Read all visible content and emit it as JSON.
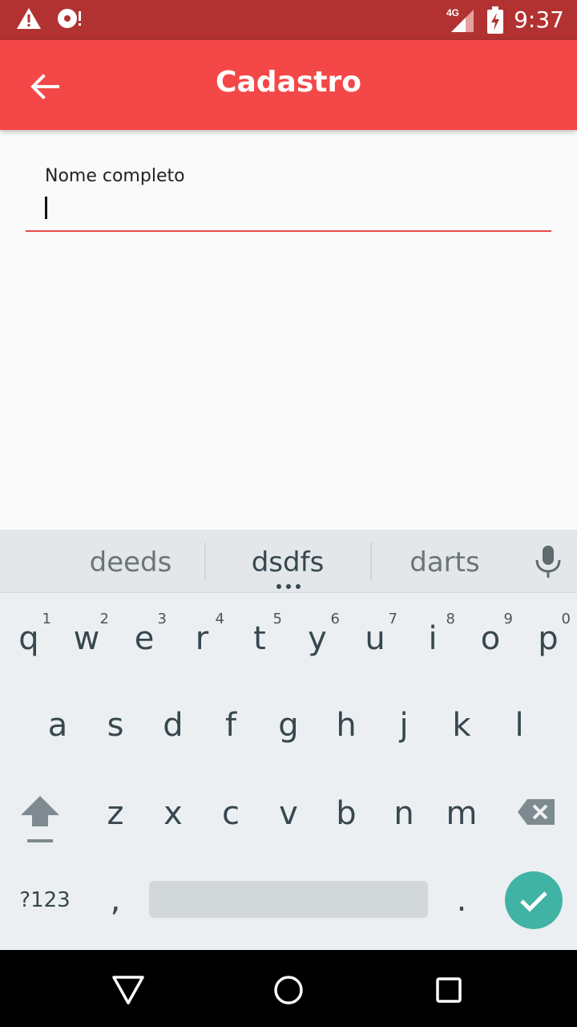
{
  "status_bar": {
    "time": "9:37",
    "network": "4G",
    "icons": [
      "warning-icon",
      "disc-icon",
      "signal-icon",
      "battery-charging-icon"
    ]
  },
  "app_bar": {
    "title": "Cadastro",
    "back_icon": "arrow-back-icon"
  },
  "form": {
    "name_label": "Nome completo",
    "name_value": ""
  },
  "keyboard": {
    "suggestions": [
      "deeds",
      "dsdfs",
      "darts"
    ],
    "row1": [
      {
        "key": "q",
        "hint": "1"
      },
      {
        "key": "w",
        "hint": "2"
      },
      {
        "key": "e",
        "hint": "3"
      },
      {
        "key": "r",
        "hint": "4"
      },
      {
        "key": "t",
        "hint": "5"
      },
      {
        "key": "y",
        "hint": "6"
      },
      {
        "key": "u",
        "hint": "7"
      },
      {
        "key": "i",
        "hint": "8"
      },
      {
        "key": "o",
        "hint": "9"
      },
      {
        "key": "p",
        "hint": "0"
      }
    ],
    "row2": [
      "a",
      "s",
      "d",
      "f",
      "g",
      "h",
      "j",
      "k",
      "l"
    ],
    "row3": [
      "z",
      "x",
      "c",
      "v",
      "b",
      "n",
      "m"
    ],
    "symbols_label": "?123",
    "comma": ",",
    "period": ".",
    "accent_color": "#40b3a5"
  },
  "nav_bar": {
    "buttons": [
      "back-triangle-icon",
      "home-circle-icon",
      "recents-square-icon"
    ]
  },
  "colors": {
    "status_bar": "#b23232",
    "app_bar": "#f44848",
    "field_underline": "#e24a4a"
  }
}
